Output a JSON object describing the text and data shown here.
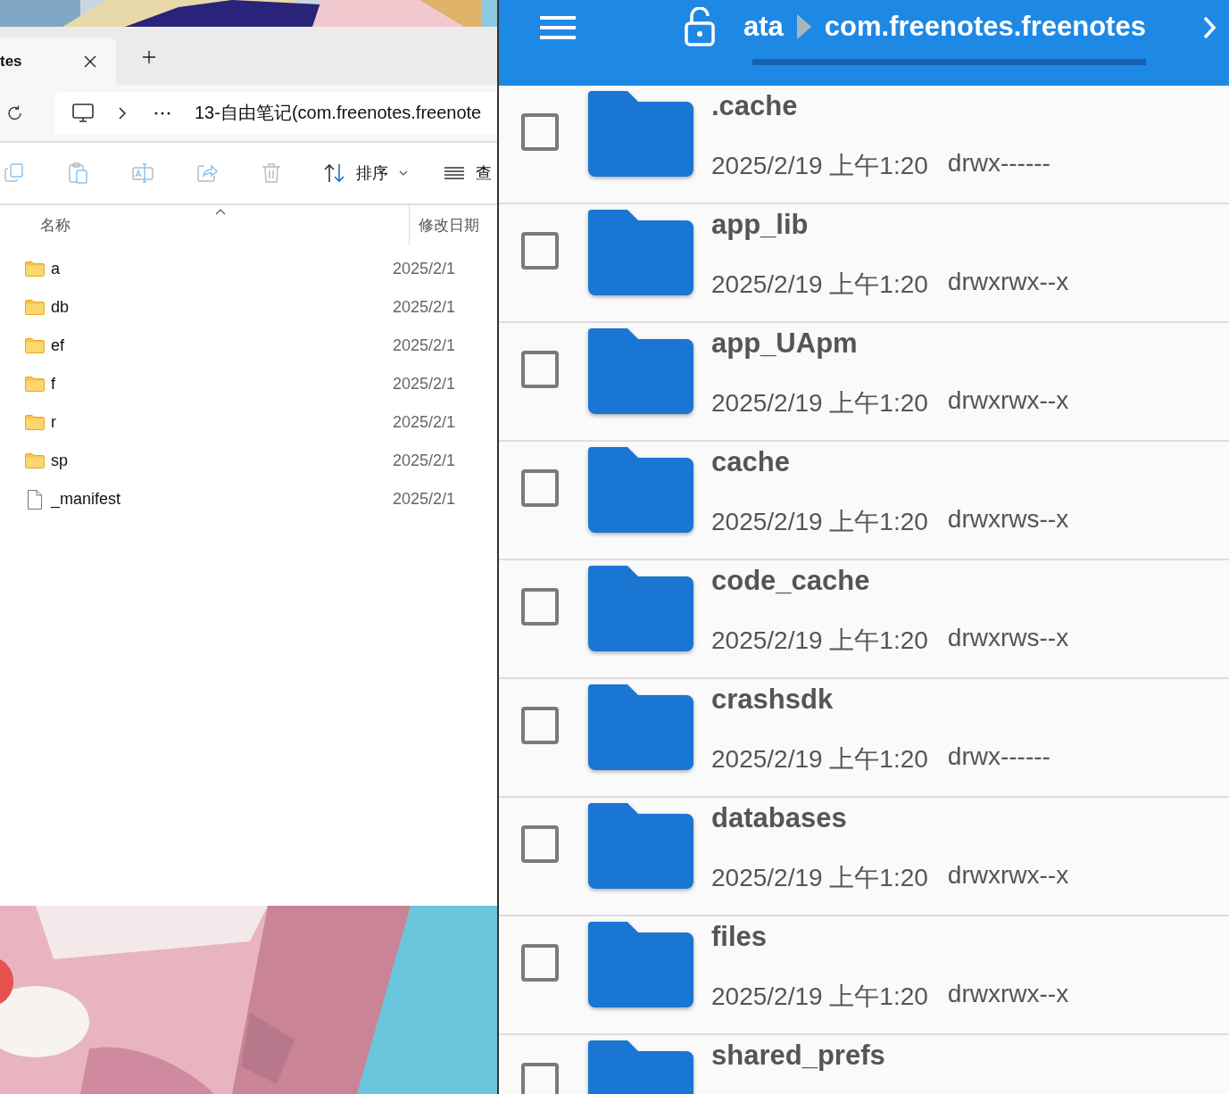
{
  "explorer": {
    "tab": {
      "title": "tes"
    },
    "address": "13-自由笔记(com.freenotes.freenote",
    "toolbar": {
      "sort_label": "排序",
      "view_label": "查"
    },
    "columns": [
      "名称",
      "修改日期"
    ],
    "rows": [
      {
        "name": "a",
        "kind": "folder",
        "date": "2025/2/1"
      },
      {
        "name": "db",
        "kind": "folder",
        "date": "2025/2/1"
      },
      {
        "name": "ef",
        "kind": "folder",
        "date": "2025/2/1"
      },
      {
        "name": "f",
        "kind": "folder",
        "date": "2025/2/1"
      },
      {
        "name": "r",
        "kind": "folder",
        "date": "2025/2/1"
      },
      {
        "name": "sp",
        "kind": "folder",
        "date": "2025/2/1"
      },
      {
        "name": "_manifest",
        "kind": "file",
        "date": "2025/2/1"
      }
    ]
  },
  "file_manager": {
    "breadcrumb": [
      "ata",
      "com.freenotes.freenotes"
    ],
    "items": [
      {
        "name": ".cache",
        "date": "2025/2/19 上午1:20",
        "permissions": "drwx------",
        "checked": false
      },
      {
        "name": "app_lib",
        "date": "2025/2/19 上午1:20",
        "permissions": "drwxrwx--x",
        "checked": false
      },
      {
        "name": "app_UApm",
        "date": "2025/2/19 上午1:20",
        "permissions": "drwxrwx--x",
        "checked": false
      },
      {
        "name": "cache",
        "date": "2025/2/19 上午1:20",
        "permissions": "drwxrws--x",
        "checked": false
      },
      {
        "name": "code_cache",
        "date": "2025/2/19 上午1:20",
        "permissions": "drwxrws--x",
        "checked": false
      },
      {
        "name": "crashsdk",
        "date": "2025/2/19 上午1:20",
        "permissions": "drwx------",
        "checked": false
      },
      {
        "name": "databases",
        "date": "2025/2/19 上午1:20",
        "permissions": "drwxrwx--x",
        "checked": false
      },
      {
        "name": "files",
        "date": "2025/2/19 上午1:20",
        "permissions": "drwxrwx--x",
        "checked": false
      },
      {
        "name": "shared_prefs",
        "checked": false
      }
    ]
  }
}
